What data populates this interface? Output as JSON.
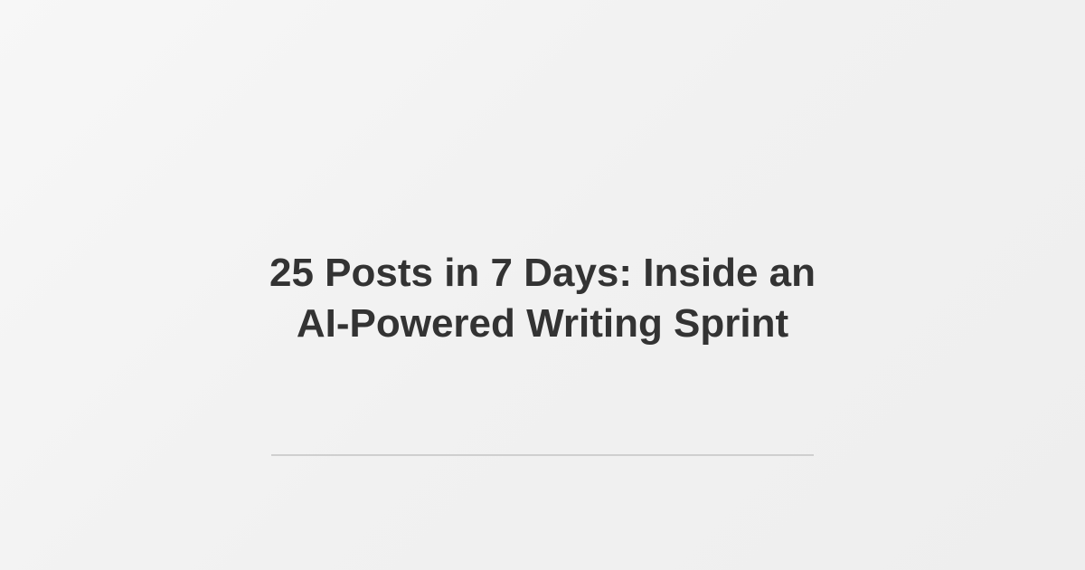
{
  "title": {
    "lines": [
      "25 Posts in 7 Days: Inside an",
      "AI-Powered Writing Sprint"
    ]
  },
  "colors": {
    "background": "#f2f2f2",
    "title_text": "#333333",
    "divider": "#cfcfcf"
  }
}
